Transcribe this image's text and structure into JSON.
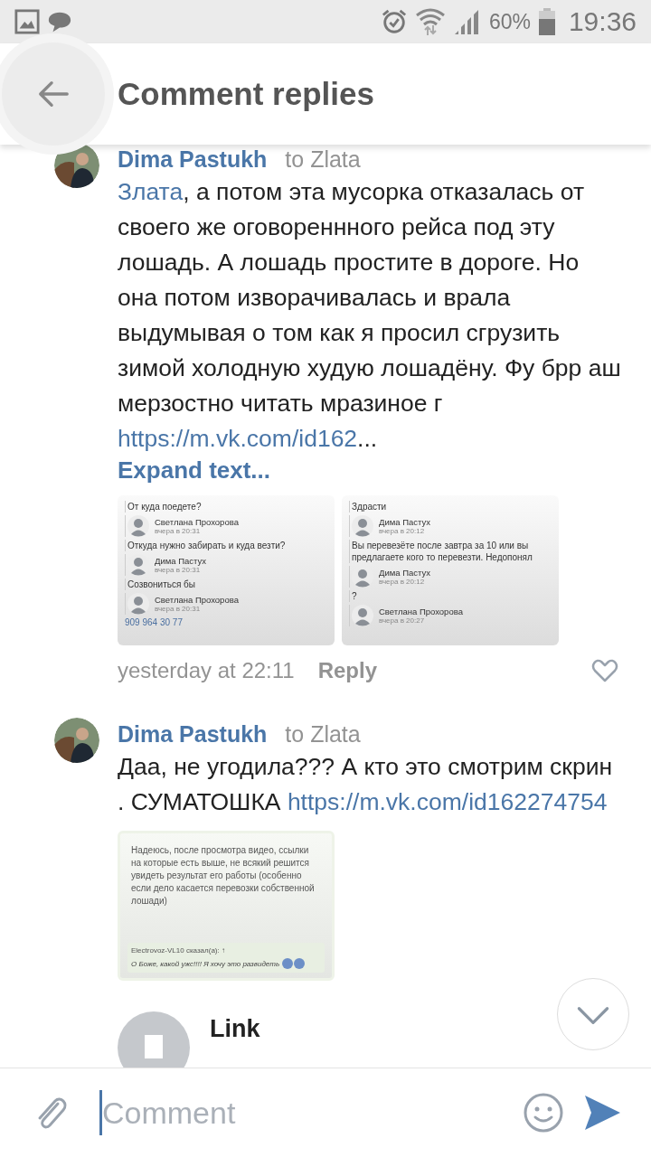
{
  "status_bar": {
    "battery_text": "60%",
    "time": "19:36"
  },
  "header": {
    "title": "Comment replies"
  },
  "comments": [
    {
      "author": "Dima Pastukh",
      "recipient": "to Zlata",
      "text": [
        {
          "kind": "mention",
          "text": "Злата"
        },
        {
          "kind": "plain",
          "text": ", а потом эта мусорка отказалась от своего же оговореннного рейса под эту лошадь. А лошадь простите в дороге. Но она потом изворачивалась и врала выдумывая о том как я просил сгрузить зимой холодную худую лошадёну. Фу брр аш мерзостно читать мразиное г "
        },
        {
          "kind": "link",
          "text": "https://m.vk.com/id162"
        },
        {
          "kind": "plain",
          "text": "..."
        }
      ],
      "expand": "Expand text...",
      "attachments": [
        {
          "kind": "chat",
          "items": [
            {
              "kind": "message",
              "text": "От куда поедете?"
            },
            {
              "kind": "author",
              "name": "Светлана Прохорова",
              "time": "вчера в 20:31"
            },
            {
              "kind": "message",
              "text": "Откуда нужно забирать и куда везти?"
            },
            {
              "kind": "author",
              "name": "Дима Пастух",
              "time": "вчера в 20:31"
            },
            {
              "kind": "message",
              "text": "Созвониться бы"
            },
            {
              "kind": "author",
              "name": "Светлана Прохорова",
              "time": "вчера в 20:31"
            },
            {
              "kind": "link",
              "text": "909 964 30 77"
            }
          ]
        },
        {
          "kind": "chat",
          "items": [
            {
              "kind": "message",
              "text": "Здрасти"
            },
            {
              "kind": "author",
              "name": "Дима Пастух",
              "time": "вчера в 20:12"
            },
            {
              "kind": "message",
              "text": "Вы перевезёте после завтра за 10 или вы предлагаете кого то перевезти. Недопонял"
            },
            {
              "kind": "author",
              "name": "Дима Пастух",
              "time": "вчера в 20:12"
            },
            {
              "kind": "message",
              "text": "?"
            },
            {
              "kind": "author",
              "name": "Светлана Прохорова",
              "time": "вчера в 20:27"
            }
          ]
        }
      ],
      "time": "yesterday at 22:11",
      "reply": "Reply",
      "liked": false
    },
    {
      "author": "Dima Pastukh",
      "recipient": "to Zlata",
      "text": [
        {
          "kind": "plain",
          "text": "Даа, не угодила??? А кто это смотрим скрин . СУМАТОШКА "
        },
        {
          "kind": "link",
          "text": "https://m.vk.com/id162274754"
        }
      ],
      "attachments": [
        {
          "kind": "post",
          "text": "Надеюсь, после просмотра видео, ссылки на которые есть выше, не всякий решится увидеть результат его работы (особенно если дело касается перевозки собственной лошади)",
          "quote_author": "Electrovoz-VL10 сказал(а): ↑",
          "quote_text": "О Боже, какой ужс!!!! Я хочу это развидеть"
        }
      ]
    }
  ],
  "link_item": {
    "title": "Link"
  },
  "composer": {
    "placeholder": "Comment"
  }
}
